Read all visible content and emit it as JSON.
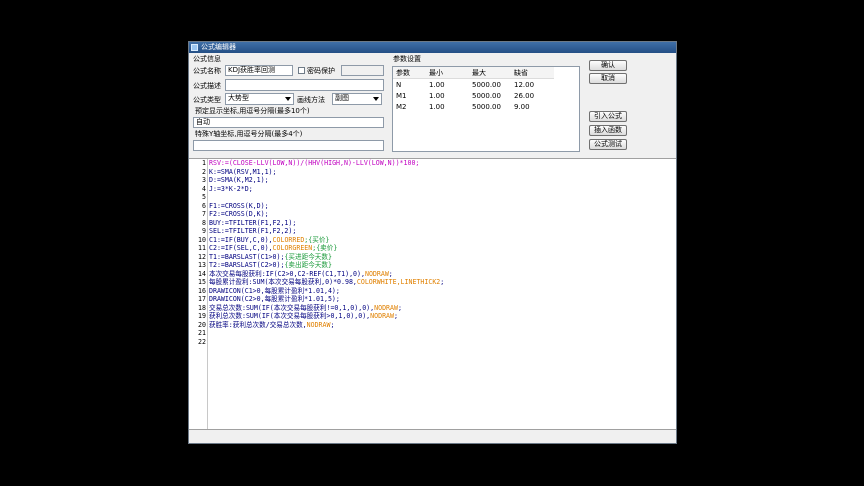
{
  "window": {
    "title": "公式编辑器"
  },
  "formula_info": {
    "group_label": "公式信息",
    "name_label": "公式名称",
    "name_value": "KDJ获胜率回测",
    "password_label": "密码保护",
    "desc_label": "公式描述",
    "desc_value": "",
    "type_label": "公式类型",
    "type_value": "大势型",
    "draw_method_label": "画线方法",
    "draw_method_value": "副图",
    "coords_label": "预定显示坐标,用逗号分隔(最多10个)",
    "coords_value": "自动",
    "yaxis_label": "特殊Y轴坐标,用逗号分隔(最多4个)",
    "yaxis_value": ""
  },
  "params": {
    "group_label": "参数设置",
    "columns": [
      "参数",
      "最小",
      "最大",
      "缺省"
    ],
    "rows": [
      [
        "N",
        "1.00",
        "5000.00",
        "12.00"
      ],
      [
        "M1",
        "1.00",
        "5000.00",
        "26.00"
      ],
      [
        "M2",
        "1.00",
        "5000.00",
        "9.00"
      ]
    ]
  },
  "buttons": {
    "ok": "确认",
    "cancel": "取消",
    "import": "引入公式",
    "insert_func": "插入函数",
    "test": "公式测试"
  },
  "code_lines": [
    [
      {
        "t": "RSV:=(CLOSE-LLV(LOW,N))/(HHV(HIGH,N)-LLV(LOW,N))*100;",
        "c": "m"
      }
    ],
    [
      {
        "t": "K:=SMA(RSV,M1,1);",
        "c": "code"
      }
    ],
    [
      {
        "t": "D:=SMA(K,M2,1);",
        "c": "code"
      }
    ],
    [
      {
        "t": "J:=3*K-2*D;",
        "c": "code"
      }
    ],
    [],
    [
      {
        "t": "F1:=CROSS(K,D);",
        "c": "code"
      }
    ],
    [
      {
        "t": "F2:=CROSS(D,K);",
        "c": "code"
      }
    ],
    [
      {
        "t": "BUY:=TFILTER(F1,F2,1);",
        "c": "code"
      }
    ],
    [
      {
        "t": "SEL:=TFILTER(F1,F2,2);",
        "c": "code"
      }
    ],
    [
      {
        "t": "C1:=IF(BUY,C,0),",
        "c": "code"
      },
      {
        "t": "COLORRED",
        "c": "o"
      },
      {
        "t": ";{买价}",
        "c": "g"
      }
    ],
    [
      {
        "t": "C2:=IF(SEL,C,0),",
        "c": "code"
      },
      {
        "t": "COLORGREEN",
        "c": "o"
      },
      {
        "t": ";{卖价}",
        "c": "g"
      }
    ],
    [
      {
        "t": "T1:=BARSLAST(C1>0);",
        "c": "code"
      },
      {
        "t": "{买进距今天数}",
        "c": "g"
      }
    ],
    [
      {
        "t": "T2:=BARSLAST(C2>0);",
        "c": "code"
      },
      {
        "t": "{卖出距今天数}",
        "c": "g"
      }
    ],
    [
      {
        "t": "本次交易每股获利:IF(C2>0,C2-REF(C1,T1),0),",
        "c": "code"
      },
      {
        "t": "NODRAW",
        "c": "o"
      },
      {
        "t": ";",
        "c": "code"
      }
    ],
    [
      {
        "t": "每股累计盈利:SUM(本次交易每股获利,0)*0.98,",
        "c": "code"
      },
      {
        "t": "COLORWHITE,LINETHICK2",
        "c": "o"
      },
      {
        "t": ";",
        "c": "code"
      }
    ],
    [
      {
        "t": "DRAWICON(C1>0,每股累计盈利*1.01,4);",
        "c": "code"
      }
    ],
    [
      {
        "t": "DRAWICON(C2>0,每股累计盈利*1.01,5);",
        "c": "code"
      }
    ],
    [
      {
        "t": "交易总次数:SUM(IF(本次交易每股获利!=0,1,0),0),",
        "c": "code"
      },
      {
        "t": "NODRAW",
        "c": "o"
      },
      {
        "t": ";",
        "c": "code"
      }
    ],
    [
      {
        "t": "获利总次数:SUM(IF(本次交易每股获利>0,1,0),0),",
        "c": "code"
      },
      {
        "t": "NODRAW",
        "c": "o"
      },
      {
        "t": ";",
        "c": "code"
      }
    ],
    [
      {
        "t": "获胜率:获利总次数/交易总次数,",
        "c": "code"
      },
      {
        "t": "NODRAW",
        "c": "o"
      },
      {
        "t": ";",
        "c": "code"
      }
    ],
    [],
    []
  ]
}
